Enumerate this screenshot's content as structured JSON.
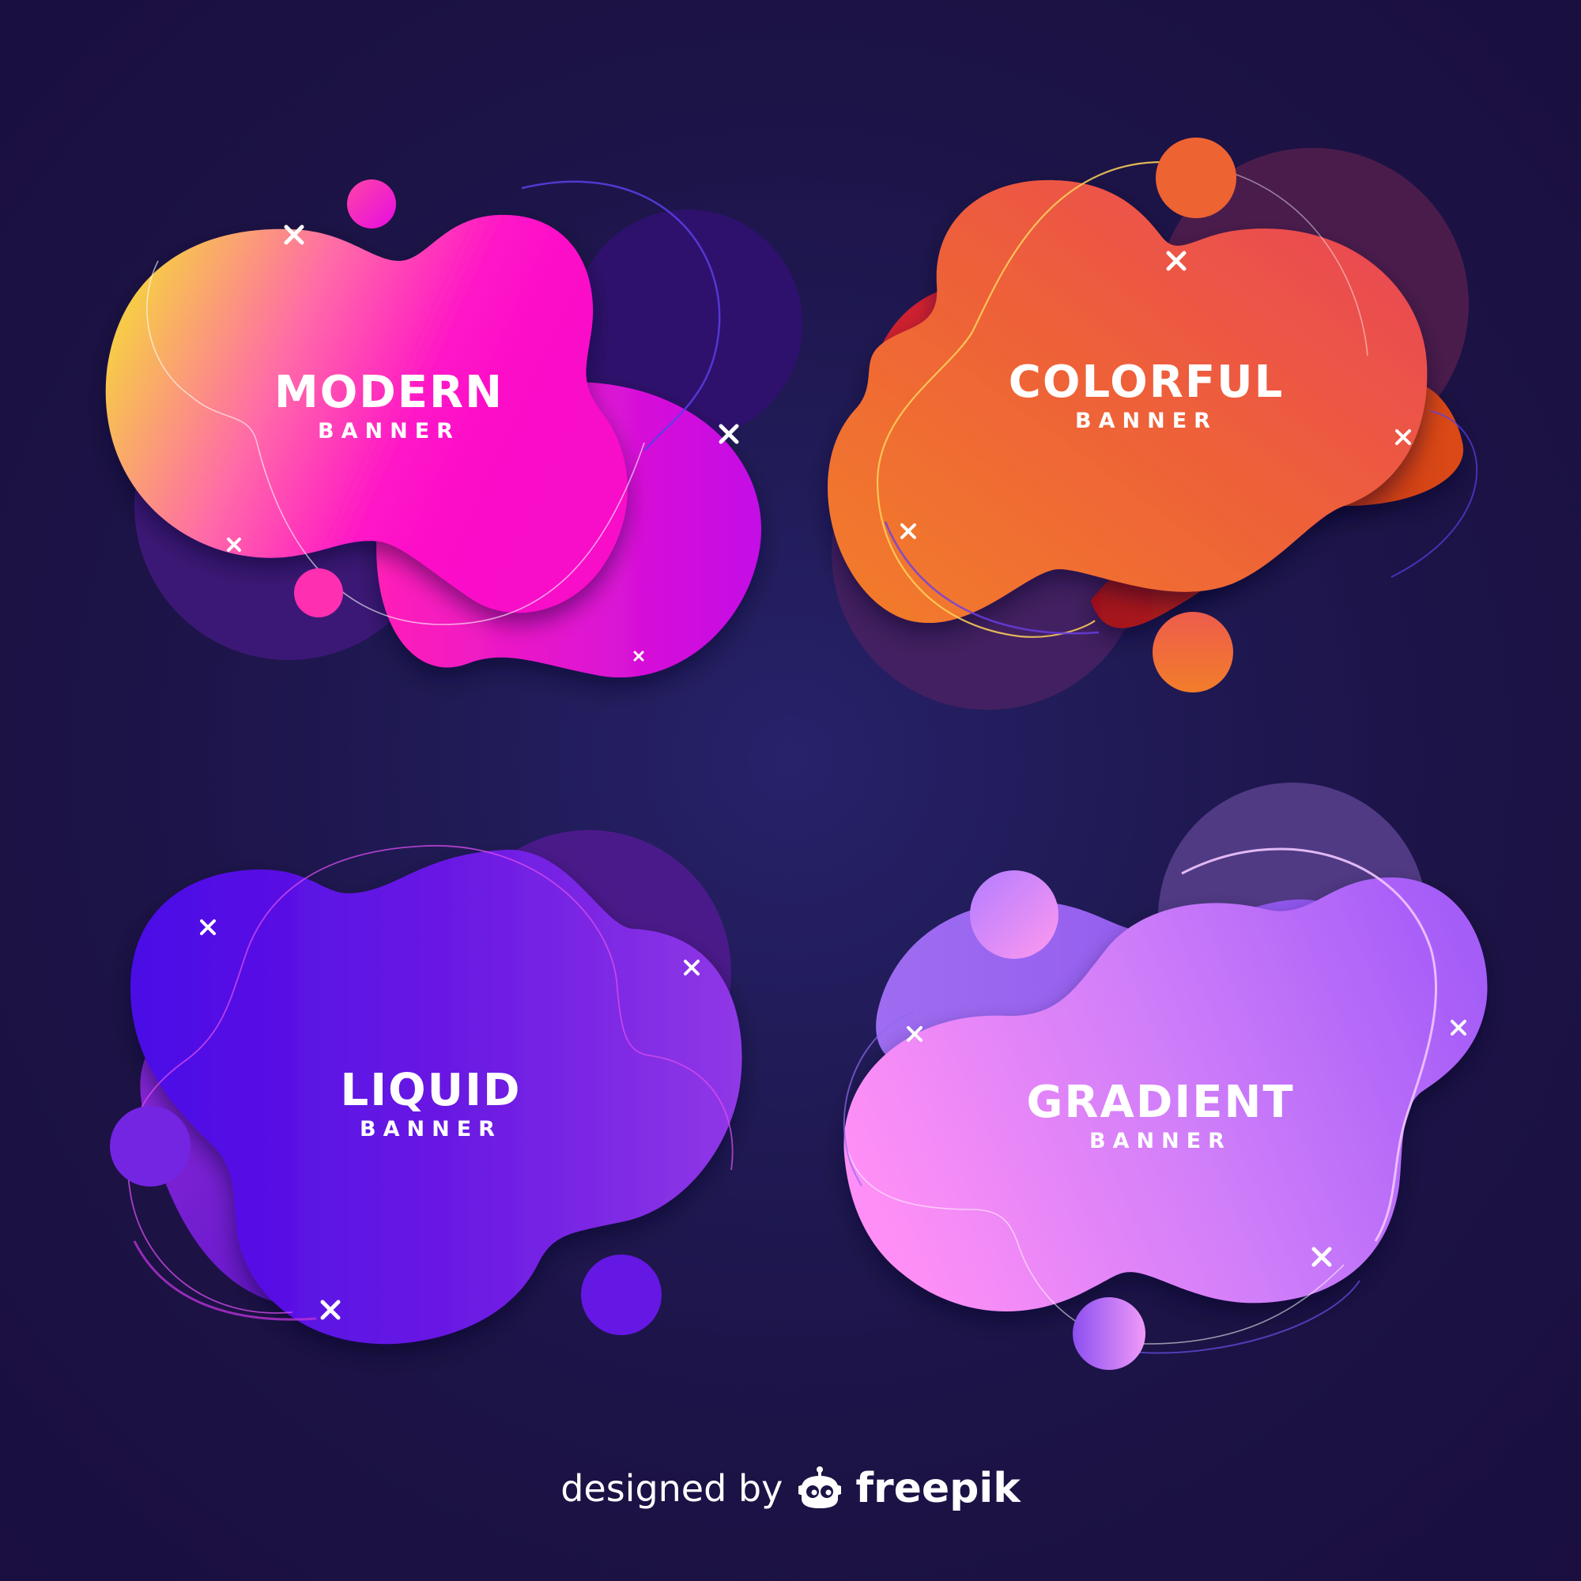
{
  "banners": [
    {
      "id": "modern",
      "title": "MODERN",
      "subtitle": "BANNER"
    },
    {
      "id": "colorful",
      "title": "COLORFUL",
      "subtitle": "BANNER"
    },
    {
      "id": "liquid",
      "title": "LIQUID",
      "subtitle": "BANNER"
    },
    {
      "id": "gradient",
      "title": "GRADIENT",
      "subtitle": "BANNER"
    }
  ],
  "credit": {
    "prefix": "designed by",
    "brand": "freepik"
  },
  "colors": {
    "background": "#1c1346",
    "modern": [
      "#f6d644",
      "#ff12c8",
      "#c40ae6"
    ],
    "colorful": [
      "#ef7a2b",
      "#ec4558",
      "#d2242f"
    ],
    "liquid": [
      "#4a0ae8",
      "#9038e6"
    ],
    "gradient": [
      "#ff90f4",
      "#a55df8"
    ]
  }
}
